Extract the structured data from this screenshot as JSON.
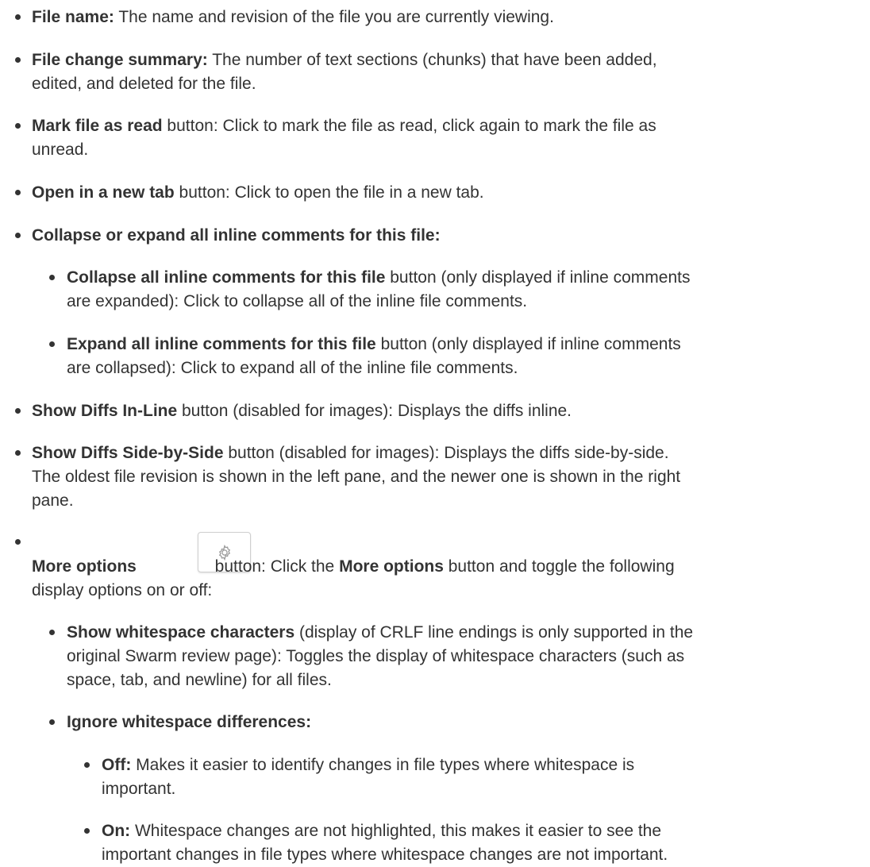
{
  "items": [
    {
      "bold": "File name:",
      "text": " The name and revision of the file you are currently viewing."
    },
    {
      "bold": "File change summary:",
      "text": " The number of text sections (chunks) that have been added,",
      "text2": "edited, and deleted for the file."
    },
    {
      "bold": "Mark file as read",
      "text": " button: Click to mark the file as read, click again to mark the file as",
      "text2": "unread."
    },
    {
      "bold": "Open in a new tab",
      "text": " button: Click to open the file in a new tab."
    },
    {
      "bold": "Collapse or expand all inline comments for this file:"
    },
    {
      "bold": "Collapse all inline comments for this file",
      "text": " button (only displayed if inline comments",
      "text2": "are expanded): Click to collapse all of the inline file comments."
    },
    {
      "bold": "Expand all inline comments for this file",
      "text": " button (only displayed if inline comments",
      "text2": "are collapsed): Click to expand all of the inline file comments."
    },
    {
      "bold": "Show Diffs In-Line",
      "text": " button (disabled for images): Displays the diffs inline."
    },
    {
      "bold": "Show Diffs Side-by-Side",
      "text": " button (disabled for images): Displays the diffs side-by-side.",
      "text2": "The oldest file revision is shown in the left pane, and the newer one is shown in the right",
      "text3": "pane."
    },
    {
      "bold": "More options",
      "text": " button: Click the ",
      "bold2": "More options",
      "text_after": " button and toggle the following",
      "text2": "display options on or off:"
    },
    {
      "bold": "Show whitespace characters",
      "text": " (display of CRLF line endings is only supported in the",
      "text2": "original Swarm review page): Toggles the display of whitespace characters (such as",
      "text3": "space, tab, and newline) for all files."
    },
    {
      "bold": "Ignore whitespace differences:"
    },
    {
      "bold": "Off:",
      "text": " Makes it easier to identify changes in file types where whitespace is",
      "text2": "important."
    },
    {
      "bold": "On:",
      "text": " Whitespace changes are not highlighted, this makes it easier to see the",
      "text2": "important changes in file types where whitespace changes are not important."
    }
  ],
  "icons": {
    "gear": "gear-icon"
  }
}
